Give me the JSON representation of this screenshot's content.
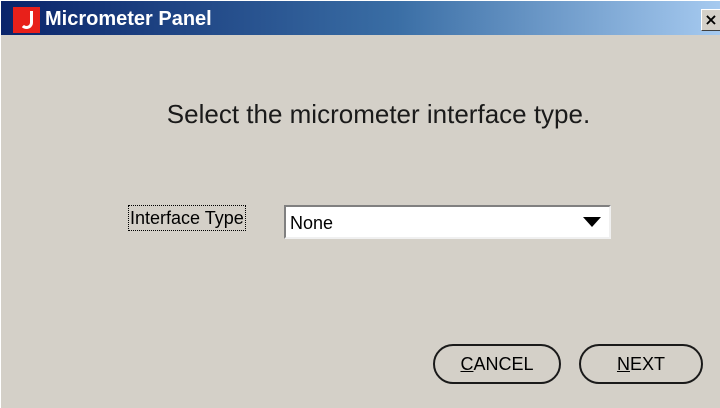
{
  "window": {
    "title": "Micrometer Panel",
    "close_glyph": "×",
    "icon": "app-crescent-icon"
  },
  "content": {
    "prompt": "Select the micrometer interface type.",
    "interface_type_label": "Interface Type",
    "interface_type_value": "None"
  },
  "buttons": {
    "cancel": {
      "mnemonic": "C",
      "rest": "ANCEL"
    },
    "next": {
      "mnemonic": "N",
      "rest": "EXT"
    }
  },
  "colors": {
    "title_gradient_start": "#0a246a",
    "title_gradient_end": "#a6caf0",
    "icon_red": "#e8201a",
    "dialog_bg": "#d4d0c8"
  }
}
